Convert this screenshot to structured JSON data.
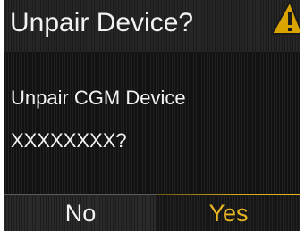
{
  "dialog": {
    "title": "Unpair Device?",
    "message_line1": "Unpair CGM Device",
    "message_line2": "XXXXXXXX?"
  },
  "icons": {
    "warning": "warning-triangle-icon"
  },
  "buttons": {
    "no_label": "No",
    "yes_label": "Yes"
  },
  "colors": {
    "background": "#121212",
    "text": "#f2f2f2",
    "accent": "#e8b620",
    "warning_fill": "#d9a400"
  }
}
